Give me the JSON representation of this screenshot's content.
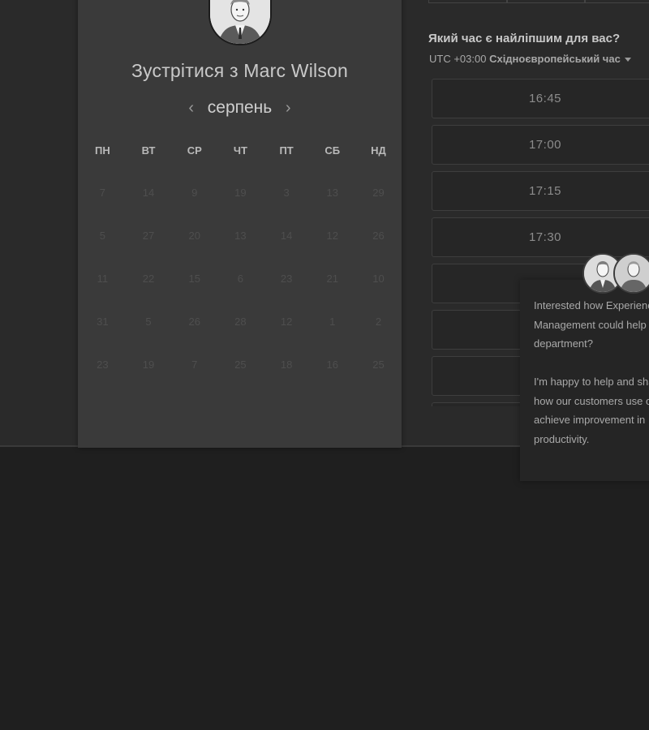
{
  "meeting": {
    "title": "Зустрітися з Marc Wilson",
    "avatar_icon": "person-avatar"
  },
  "calendar": {
    "month": "серпень",
    "prev_icon": "chevron-left-icon",
    "next_icon": "chevron-right-icon",
    "weekdays": [
      "ПН",
      "ВТ",
      "СР",
      "ЧТ",
      "ПТ",
      "СБ",
      "НД"
    ],
    "weeks": [
      [
        "7",
        "14",
        "9",
        "19",
        "3",
        "13",
        "29"
      ],
      [
        "5",
        "27",
        "20",
        "13",
        "14",
        "12",
        "26"
      ],
      [
        "11",
        "22",
        "15",
        "6",
        "23",
        "21",
        "10"
      ],
      [
        "31",
        "5",
        "26",
        "28",
        "12",
        "1",
        "2"
      ],
      [
        "23",
        "19",
        "7",
        "25",
        "18",
        "16",
        "25"
      ]
    ]
  },
  "time_picker": {
    "question": "Який час є найліпшим для вас?",
    "timezone_prefix": "UTC +03:00 ",
    "timezone_name": "Східноєвропейський час",
    "timezone_icon": "caret-down-icon",
    "slots": [
      "16:45",
      "17:00",
      "17:15",
      "17:30",
      "",
      "",
      "",
      ""
    ]
  },
  "chat": {
    "paragraph1": "Interested how Experience Management could help your IT department?",
    "paragraph2": "I'm happy to help and share insight into how our customers use our platform to achieve improvement in IT end-user productivity."
  },
  "colors": {
    "page_bg": "#1f1f1f",
    "card_bg": "#3a3a3a",
    "slot_bg": "#262626",
    "text": "#cfcfcf",
    "muted_day": "#4e4e4e"
  }
}
